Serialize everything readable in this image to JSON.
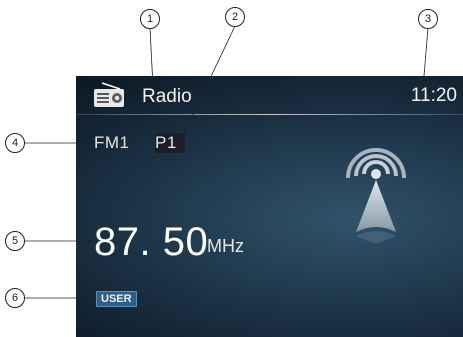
{
  "header": {
    "title": "Radio",
    "clock": "11:20",
    "icon": "radio-icon"
  },
  "tuner": {
    "band": "FM1",
    "preset": "P1",
    "frequency": "87. 50",
    "unit": "MHz",
    "mode_badge": "USER",
    "station_icon": "broadcast-tower-icon"
  },
  "callouts": [
    "1",
    "2",
    "3",
    "4",
    "5",
    "6"
  ],
  "colors": {
    "screen_bg": "#0c1721",
    "badge_bg": "#2f5f86",
    "icon_silver": "#c8d0d8"
  }
}
